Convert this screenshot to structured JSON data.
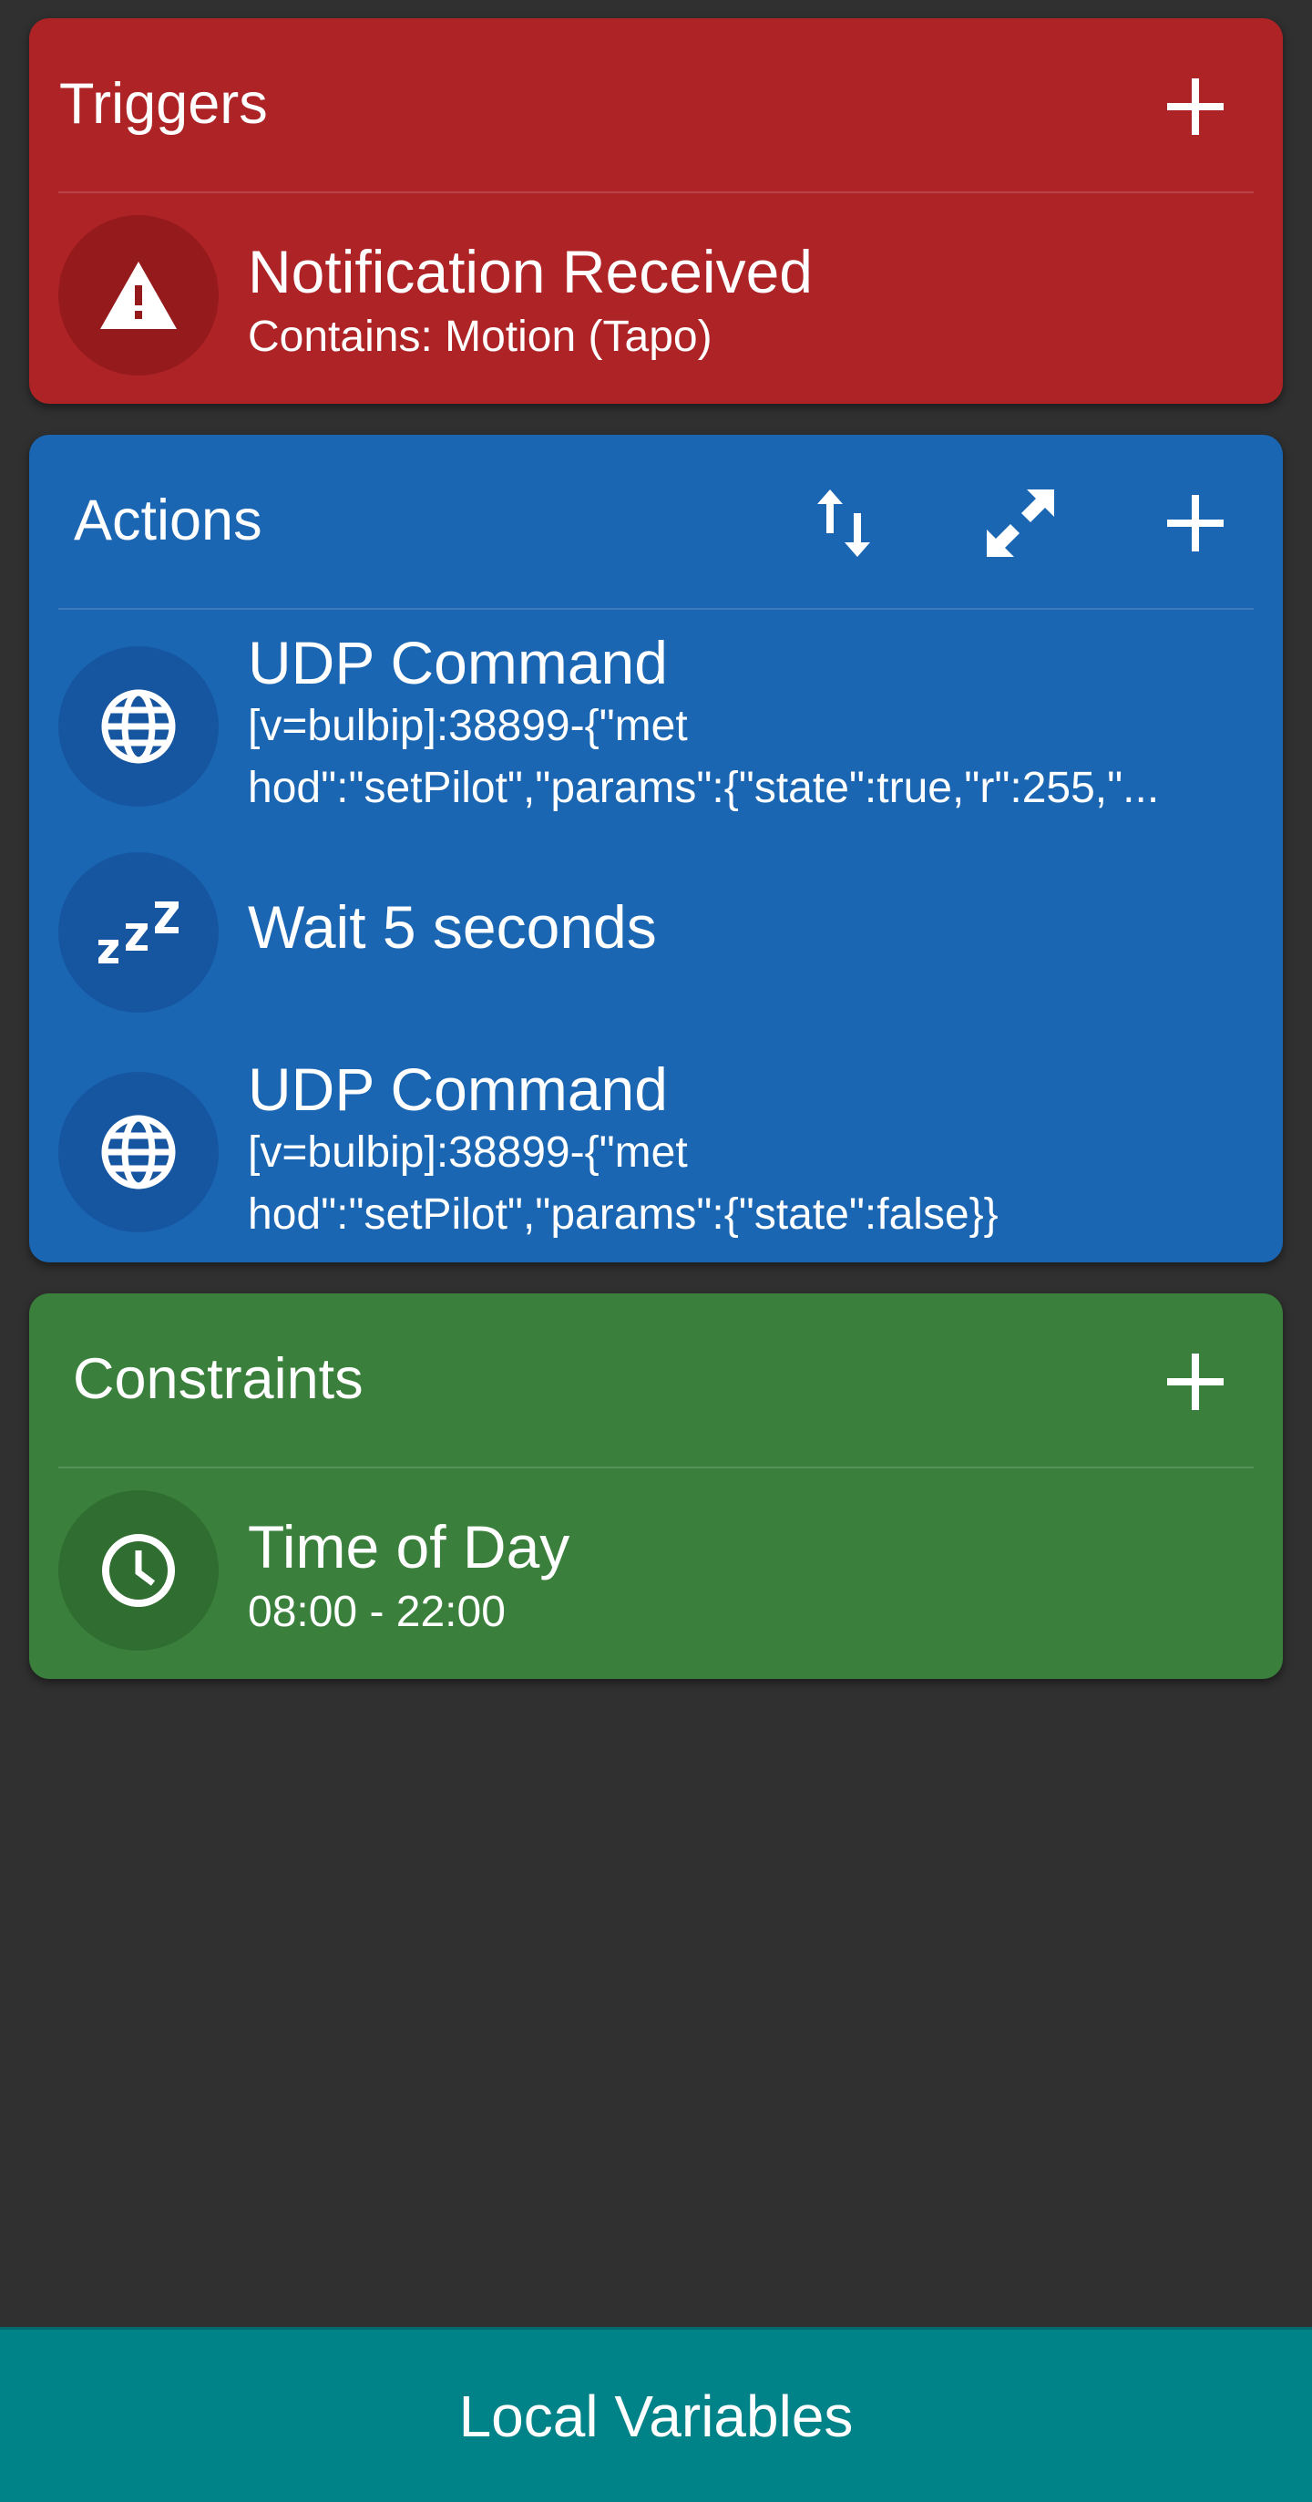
{
  "triggers": {
    "title": "Triggers",
    "items": [
      {
        "icon": "warning-icon",
        "title": "Notification Received",
        "detail": "Contains: Motion (Tapo)"
      }
    ]
  },
  "actions": {
    "title": "Actions",
    "items": [
      {
        "icon": "globe-icon",
        "title": "UDP Command",
        "detail_line1": "[v=bulbip]:38899-{\"met",
        "detail_line2": "hod\":\"setPilot\",\"params\":{\"state\":true,\"r\":255,\"..."
      },
      {
        "icon": "sleep-icon",
        "title": "Wait 5 seconds"
      },
      {
        "icon": "globe-icon",
        "title": "UDP Command",
        "detail_line1": "[v=bulbip]:38899-{\"met",
        "detail_line2": "hod\":\"setPilot\",\"params\":{\"state\":false}}"
      }
    ]
  },
  "constraints": {
    "title": "Constraints",
    "items": [
      {
        "icon": "clock-icon",
        "title": "Time of Day",
        "detail": "08:00 - 22:00"
      }
    ]
  },
  "bottom_bar": {
    "label": "Local Variables"
  },
  "colors": {
    "background": "#303030",
    "triggers": "#AD2326",
    "actions": "#1A66B3",
    "constraints": "#3A803C",
    "bottom_bar": "#008289"
  }
}
